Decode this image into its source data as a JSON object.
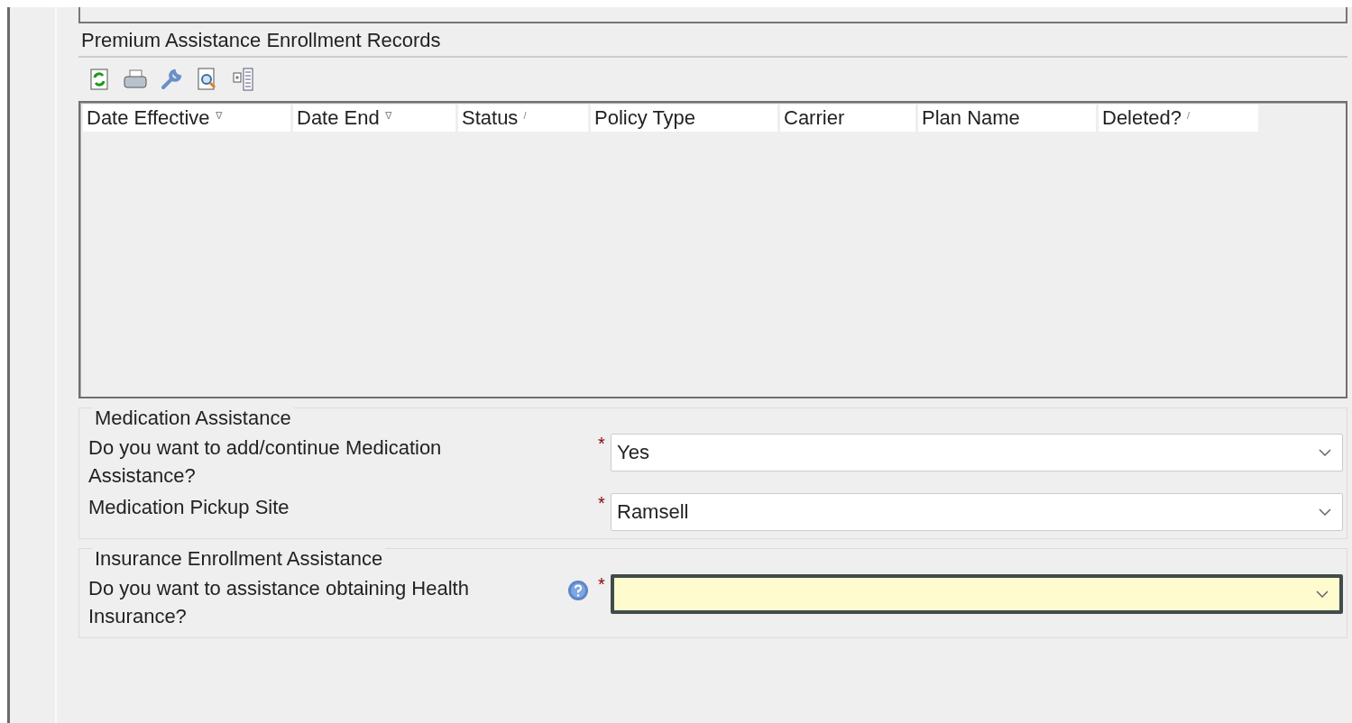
{
  "records": {
    "title": "Premium Assistance Enrollment Records",
    "toolbar": [
      {
        "kind": "refresh"
      },
      {
        "kind": "print"
      },
      {
        "kind": "wrench"
      },
      {
        "kind": "preview"
      },
      {
        "kind": "columns"
      }
    ],
    "columns": [
      {
        "label": "Date Effective",
        "mark": "ᐁ"
      },
      {
        "label": "Date End",
        "mark": "ᐁ"
      },
      {
        "label": "Status",
        "mark": "/"
      },
      {
        "label": "Policy Type"
      },
      {
        "label": "Carrier"
      },
      {
        "label": "Plan Name"
      },
      {
        "label": "Deleted?",
        "mark": "/"
      }
    ]
  },
  "sections": [
    {
      "legend": "Medication Assistance",
      "fields": [
        {
          "label": "Do you want to add/continue Medication Assistance?",
          "required_mark": "*",
          "help": false,
          "value": "Yes",
          "focused": false
        },
        {
          "label": "Medication Pickup Site",
          "required_mark": "*",
          "help": false,
          "value": "Ramsell",
          "focused": false
        }
      ]
    },
    {
      "legend": "Insurance Enrollment Assistance",
      "fields": [
        {
          "label": "Do you want to assistance obtaining Health Insurance?",
          "required_mark": "*",
          "help": true,
          "focused": true
        }
      ]
    }
  ]
}
